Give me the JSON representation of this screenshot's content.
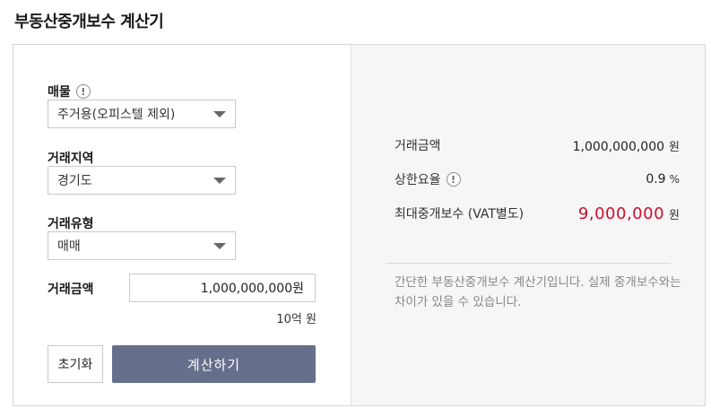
{
  "page": {
    "title": "부동산중개보수 계산기"
  },
  "form": {
    "property": {
      "label": "매물",
      "info_icon": "!",
      "selected": "주거용(오피스텔 제외)"
    },
    "region": {
      "label": "거래지역",
      "selected": "경기도"
    },
    "deal_type": {
      "label": "거래유형",
      "selected": "매매"
    },
    "amount": {
      "label": "거래금액",
      "value": "1,000,000,000원",
      "hint": "10억 원"
    },
    "reset_label": "초기화",
    "calc_label": "계산하기"
  },
  "result": {
    "amount_label": "거래금액",
    "amount_value": "1,000,000,000",
    "amount_unit": "원",
    "rate_label": "상한요율",
    "rate_info_icon": "!",
    "rate_value": "0.9",
    "rate_unit": "%",
    "max_fee_label": "최대중개보수 (VAT별도)",
    "max_fee_value": "9,000,000",
    "max_fee_unit": "원",
    "notice": "간단한 부동산중개보수 계산기입니다. 실제 중개보수와는 차이가 있을 수 있습니다."
  },
  "colors": {
    "accent_button": "#666f8c",
    "fee_red": "#c8102e",
    "panel_bg": "#f6f6f6"
  }
}
